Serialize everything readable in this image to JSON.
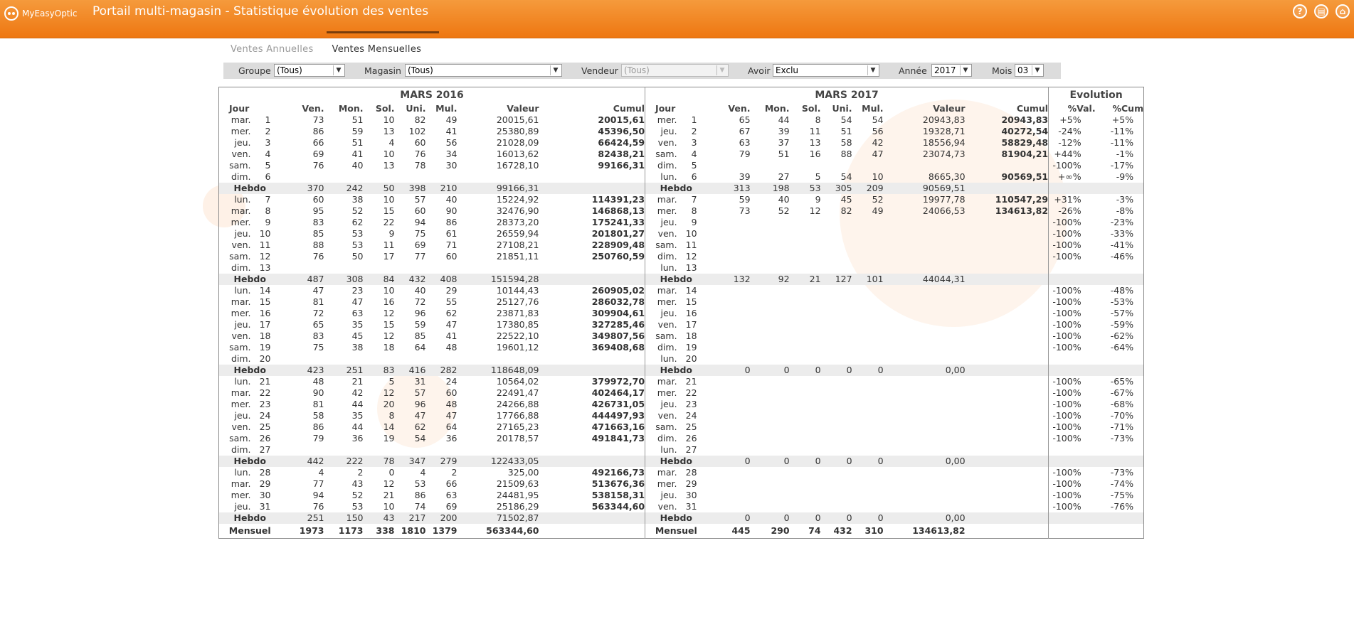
{
  "app": {
    "logo_text": "MyEasyOptic",
    "title": "Portail multi-magasin - Statistique évolution des ventes"
  },
  "tabs": [
    "Ventes Annuelles",
    "Ventes Mensuelles"
  ],
  "filters": {
    "groupe": {
      "label": "Groupe",
      "value": "(Tous)"
    },
    "magasin": {
      "label": "Magasin",
      "value": "(Tous)"
    },
    "vendeur": {
      "label": "Vendeur",
      "value": "(Tous)"
    },
    "avoir": {
      "label": "Avoir",
      "value": "Exclu"
    },
    "annee": {
      "label": "Année",
      "value": "2017"
    },
    "mois": {
      "label": "Mois",
      "value": "03"
    }
  },
  "table": {
    "left_title": "MARS 2016",
    "right_title": "MARS 2017",
    "evo_title": "Evolution",
    "col_headers": [
      "Jour",
      "Ven.",
      "Mon.",
      "Sol.",
      "Uni.",
      "Mul.",
      "Valeur",
      "Cumul"
    ],
    "evo_headers": [
      "%Val.",
      "%Cum"
    ],
    "hebdo_label": "Hebdo",
    "mensuel_label": "Mensuel",
    "rows": [
      {
        "t": "d",
        "l": [
          "mar.",
          "1",
          "73",
          "51",
          "10",
          "82",
          "49",
          "20015,61",
          "20015,61"
        ],
        "r": [
          "mer.",
          "1",
          "65",
          "44",
          "8",
          "54",
          "54",
          "20943,83",
          "20943,83"
        ],
        "e": [
          "+5%",
          "+5%"
        ]
      },
      {
        "t": "d",
        "l": [
          "mer.",
          "2",
          "86",
          "59",
          "13",
          "102",
          "41",
          "25380,89",
          "45396,50"
        ],
        "r": [
          "jeu.",
          "2",
          "67",
          "39",
          "11",
          "51",
          "56",
          "19328,71",
          "40272,54"
        ],
        "e": [
          "-24%",
          "-11%"
        ]
      },
      {
        "t": "d",
        "l": [
          "jeu.",
          "3",
          "66",
          "51",
          "4",
          "60",
          "56",
          "21028,09",
          "66424,59"
        ],
        "r": [
          "ven.",
          "3",
          "63",
          "37",
          "13",
          "58",
          "42",
          "18556,94",
          "58829,48"
        ],
        "e": [
          "-12%",
          "-11%"
        ]
      },
      {
        "t": "d",
        "l": [
          "ven.",
          "4",
          "69",
          "41",
          "10",
          "76",
          "34",
          "16013,62",
          "82438,21"
        ],
        "r": [
          "sam.",
          "4",
          "79",
          "51",
          "16",
          "88",
          "47",
          "23074,73",
          "81904,21"
        ],
        "e": [
          "+44%",
          "-1%"
        ]
      },
      {
        "t": "d",
        "l": [
          "sam.",
          "5",
          "76",
          "40",
          "13",
          "78",
          "30",
          "16728,10",
          "99166,31"
        ],
        "r": [
          "dim.",
          "5",
          "",
          "",
          "",
          "",
          "",
          "",
          ""
        ],
        "e": [
          "-100%",
          "-17%"
        ]
      },
      {
        "t": "d",
        "l": [
          "dim.",
          "6",
          "",
          "",
          "",
          "",
          "",
          "",
          ""
        ],
        "r": [
          "lun.",
          "6",
          "39",
          "27",
          "5",
          "54",
          "10",
          "8665,30",
          "90569,51"
        ],
        "e": [
          "+∞%",
          "-9%"
        ]
      },
      {
        "t": "h",
        "l": [
          "370",
          "242",
          "50",
          "398",
          "210",
          "99166,31"
        ],
        "r": [
          "313",
          "198",
          "53",
          "305",
          "209",
          "90569,51"
        ]
      },
      {
        "t": "d",
        "l": [
          "lun.",
          "7",
          "60",
          "38",
          "10",
          "57",
          "40",
          "15224,92",
          "114391,23"
        ],
        "r": [
          "mar.",
          "7",
          "59",
          "40",
          "9",
          "45",
          "52",
          "19977,78",
          "110547,29"
        ],
        "e": [
          "+31%",
          "-3%"
        ]
      },
      {
        "t": "d",
        "l": [
          "mar.",
          "8",
          "95",
          "52",
          "15",
          "60",
          "90",
          "32476,90",
          "146868,13"
        ],
        "r": [
          "mer.",
          "8",
          "73",
          "52",
          "12",
          "82",
          "49",
          "24066,53",
          "134613,82"
        ],
        "e": [
          "-26%",
          "-8%"
        ]
      },
      {
        "t": "d",
        "l": [
          "mer.",
          "9",
          "83",
          "62",
          "22",
          "94",
          "86",
          "28373,20",
          "175241,33"
        ],
        "r": [
          "jeu.",
          "9",
          "",
          "",
          "",
          "",
          "",
          "",
          ""
        ],
        "e": [
          "-100%",
          "-23%"
        ]
      },
      {
        "t": "d",
        "l": [
          "jeu.",
          "10",
          "85",
          "53",
          "9",
          "75",
          "61",
          "26559,94",
          "201801,27"
        ],
        "r": [
          "ven.",
          "10",
          "",
          "",
          "",
          "",
          "",
          "",
          ""
        ],
        "e": [
          "-100%",
          "-33%"
        ]
      },
      {
        "t": "d",
        "l": [
          "ven.",
          "11",
          "88",
          "53",
          "11",
          "69",
          "71",
          "27108,21",
          "228909,48"
        ],
        "r": [
          "sam.",
          "11",
          "",
          "",
          "",
          "",
          "",
          "",
          ""
        ],
        "e": [
          "-100%",
          "-41%"
        ]
      },
      {
        "t": "d",
        "l": [
          "sam.",
          "12",
          "76",
          "50",
          "17",
          "77",
          "60",
          "21851,11",
          "250760,59"
        ],
        "r": [
          "dim.",
          "12",
          "",
          "",
          "",
          "",
          "",
          "",
          ""
        ],
        "e": [
          "-100%",
          "-46%"
        ]
      },
      {
        "t": "d",
        "l": [
          "dim.",
          "13",
          "",
          "",
          "",
          "",
          "",
          "",
          ""
        ],
        "r": [
          "lun.",
          "13",
          "",
          "",
          "",
          "",
          "",
          "",
          ""
        ],
        "e": [
          "",
          ""
        ]
      },
      {
        "t": "h",
        "l": [
          "487",
          "308",
          "84",
          "432",
          "408",
          "151594,28"
        ],
        "r": [
          "132",
          "92",
          "21",
          "127",
          "101",
          "44044,31"
        ]
      },
      {
        "t": "d",
        "l": [
          "lun.",
          "14",
          "47",
          "23",
          "10",
          "40",
          "29",
          "10144,43",
          "260905,02"
        ],
        "r": [
          "mar.",
          "14",
          "",
          "",
          "",
          "",
          "",
          "",
          ""
        ],
        "e": [
          "-100%",
          "-48%"
        ]
      },
      {
        "t": "d",
        "l": [
          "mar.",
          "15",
          "81",
          "47",
          "16",
          "72",
          "55",
          "25127,76",
          "286032,78"
        ],
        "r": [
          "mer.",
          "15",
          "",
          "",
          "",
          "",
          "",
          "",
          ""
        ],
        "e": [
          "-100%",
          "-53%"
        ]
      },
      {
        "t": "d",
        "l": [
          "mer.",
          "16",
          "72",
          "63",
          "12",
          "96",
          "62",
          "23871,83",
          "309904,61"
        ],
        "r": [
          "jeu.",
          "16",
          "",
          "",
          "",
          "",
          "",
          "",
          ""
        ],
        "e": [
          "-100%",
          "-57%"
        ]
      },
      {
        "t": "d",
        "l": [
          "jeu.",
          "17",
          "65",
          "35",
          "15",
          "59",
          "47",
          "17380,85",
          "327285,46"
        ],
        "r": [
          "ven.",
          "17",
          "",
          "",
          "",
          "",
          "",
          "",
          ""
        ],
        "e": [
          "-100%",
          "-59%"
        ]
      },
      {
        "t": "d",
        "l": [
          "ven.",
          "18",
          "83",
          "45",
          "12",
          "85",
          "41",
          "22522,10",
          "349807,56"
        ],
        "r": [
          "sam.",
          "18",
          "",
          "",
          "",
          "",
          "",
          "",
          ""
        ],
        "e": [
          "-100%",
          "-62%"
        ]
      },
      {
        "t": "d",
        "l": [
          "sam.",
          "19",
          "75",
          "38",
          "18",
          "64",
          "48",
          "19601,12",
          "369408,68"
        ],
        "r": [
          "dim.",
          "19",
          "",
          "",
          "",
          "",
          "",
          "",
          ""
        ],
        "e": [
          "-100%",
          "-64%"
        ]
      },
      {
        "t": "d",
        "l": [
          "dim.",
          "20",
          "",
          "",
          "",
          "",
          "",
          "",
          ""
        ],
        "r": [
          "lun.",
          "20",
          "",
          "",
          "",
          "",
          "",
          "",
          ""
        ],
        "e": [
          "",
          ""
        ]
      },
      {
        "t": "h",
        "l": [
          "423",
          "251",
          "83",
          "416",
          "282",
          "118648,09"
        ],
        "r": [
          "0",
          "0",
          "0",
          "0",
          "0",
          "0,00"
        ]
      },
      {
        "t": "d",
        "l": [
          "lun.",
          "21",
          "48",
          "21",
          "5",
          "31",
          "24",
          "10564,02",
          "379972,70"
        ],
        "r": [
          "mar.",
          "21",
          "",
          "",
          "",
          "",
          "",
          "",
          ""
        ],
        "e": [
          "-100%",
          "-65%"
        ]
      },
      {
        "t": "d",
        "l": [
          "mar.",
          "22",
          "90",
          "42",
          "12",
          "57",
          "60",
          "22491,47",
          "402464,17"
        ],
        "r": [
          "mer.",
          "22",
          "",
          "",
          "",
          "",
          "",
          "",
          ""
        ],
        "e": [
          "-100%",
          "-67%"
        ]
      },
      {
        "t": "d",
        "l": [
          "mer.",
          "23",
          "81",
          "44",
          "20",
          "96",
          "48",
          "24266,88",
          "426731,05"
        ],
        "r": [
          "jeu.",
          "23",
          "",
          "",
          "",
          "",
          "",
          "",
          ""
        ],
        "e": [
          "-100%",
          "-68%"
        ]
      },
      {
        "t": "d",
        "l": [
          "jeu.",
          "24",
          "58",
          "35",
          "8",
          "47",
          "47",
          "17766,88",
          "444497,93"
        ],
        "r": [
          "ven.",
          "24",
          "",
          "",
          "",
          "",
          "",
          "",
          ""
        ],
        "e": [
          "-100%",
          "-70%"
        ]
      },
      {
        "t": "d",
        "l": [
          "ven.",
          "25",
          "86",
          "44",
          "14",
          "62",
          "64",
          "27165,23",
          "471663,16"
        ],
        "r": [
          "sam.",
          "25",
          "",
          "",
          "",
          "",
          "",
          "",
          ""
        ],
        "e": [
          "-100%",
          "-71%"
        ]
      },
      {
        "t": "d",
        "l": [
          "sam.",
          "26",
          "79",
          "36",
          "19",
          "54",
          "36",
          "20178,57",
          "491841,73"
        ],
        "r": [
          "dim.",
          "26",
          "",
          "",
          "",
          "",
          "",
          "",
          ""
        ],
        "e": [
          "-100%",
          "-73%"
        ]
      },
      {
        "t": "d",
        "l": [
          "dim.",
          "27",
          "",
          "",
          "",
          "",
          "",
          "",
          ""
        ],
        "r": [
          "lun.",
          "27",
          "",
          "",
          "",
          "",
          "",
          "",
          ""
        ],
        "e": [
          "",
          ""
        ]
      },
      {
        "t": "h",
        "l": [
          "442",
          "222",
          "78",
          "347",
          "279",
          "122433,05"
        ],
        "r": [
          "0",
          "0",
          "0",
          "0",
          "0",
          "0,00"
        ]
      },
      {
        "t": "d",
        "l": [
          "lun.",
          "28",
          "4",
          "2",
          "0",
          "4",
          "2",
          "325,00",
          "492166,73"
        ],
        "r": [
          "mar.",
          "28",
          "",
          "",
          "",
          "",
          "",
          "",
          ""
        ],
        "e": [
          "-100%",
          "-73%"
        ]
      },
      {
        "t": "d",
        "l": [
          "mar.",
          "29",
          "77",
          "43",
          "12",
          "53",
          "66",
          "21509,63",
          "513676,36"
        ],
        "r": [
          "mer.",
          "29",
          "",
          "",
          "",
          "",
          "",
          "",
          ""
        ],
        "e": [
          "-100%",
          "-74%"
        ]
      },
      {
        "t": "d",
        "l": [
          "mer.",
          "30",
          "94",
          "52",
          "21",
          "86",
          "63",
          "24481,95",
          "538158,31"
        ],
        "r": [
          "jeu.",
          "30",
          "",
          "",
          "",
          "",
          "",
          "",
          ""
        ],
        "e": [
          "-100%",
          "-75%"
        ]
      },
      {
        "t": "d",
        "l": [
          "jeu.",
          "31",
          "76",
          "53",
          "10",
          "74",
          "69",
          "25186,29",
          "563344,60"
        ],
        "r": [
          "ven.",
          "31",
          "",
          "",
          "",
          "",
          "",
          "",
          ""
        ],
        "e": [
          "-100%",
          "-76%"
        ]
      },
      {
        "t": "h",
        "l": [
          "251",
          "150",
          "43",
          "217",
          "200",
          "71502,87"
        ],
        "r": [
          "0",
          "0",
          "0",
          "0",
          "0",
          "0,00"
        ]
      },
      {
        "t": "m",
        "l": [
          "1973",
          "1173",
          "338",
          "1810",
          "1379",
          "563344,60"
        ],
        "r": [
          "445",
          "290",
          "74",
          "432",
          "310",
          "134613,82"
        ]
      }
    ]
  }
}
